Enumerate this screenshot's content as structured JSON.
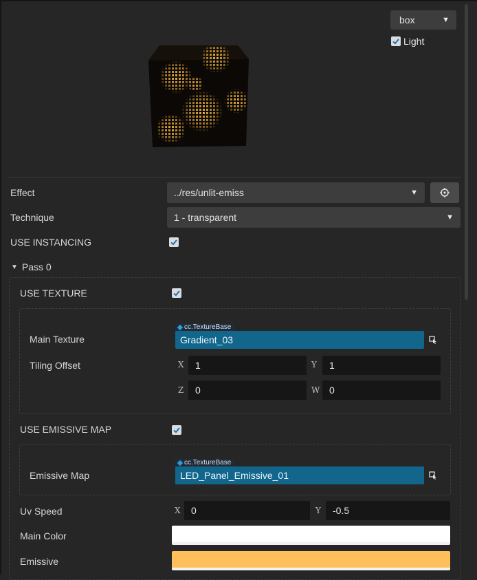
{
  "preview": {
    "mesh_select": "box",
    "light_label": "Light",
    "light_checked": true
  },
  "effect": {
    "label": "Effect",
    "value": "../res/unlit-emiss"
  },
  "technique": {
    "label": "Technique",
    "value": "1 - transparent"
  },
  "use_instancing": {
    "label": "USE INSTANCING",
    "checked": true
  },
  "pass": {
    "label": "Pass 0",
    "use_texture": {
      "label": "USE TEXTURE",
      "checked": true
    },
    "main_texture": {
      "label": "Main Texture",
      "type": "cc.TextureBase",
      "value": "Gradient_03"
    },
    "tiling_offset": {
      "label": "Tiling Offset",
      "x_label": "X",
      "x": "1",
      "y_label": "Y",
      "y": "1",
      "z_label": "Z",
      "z": "0",
      "w_label": "W",
      "w": "0"
    },
    "use_emissive_map": {
      "label": "USE EMISSIVE MAP",
      "checked": true
    },
    "emissive_map": {
      "label": "Emissive Map",
      "type": "cc.TextureBase",
      "value": "LED_Panel_Emissive_01"
    },
    "uv_speed": {
      "label": "Uv Speed",
      "x_label": "X",
      "x": "0",
      "y_label": "Y",
      "y": "-0.5"
    },
    "main_color": {
      "label": "Main Color",
      "color": "#ffffff"
    },
    "emissive": {
      "label": "Emissive",
      "color": "#ffbf5a"
    }
  },
  "colors": {
    "accent": "#12668c",
    "panel": "#262626",
    "input": "#3d3d3d"
  }
}
